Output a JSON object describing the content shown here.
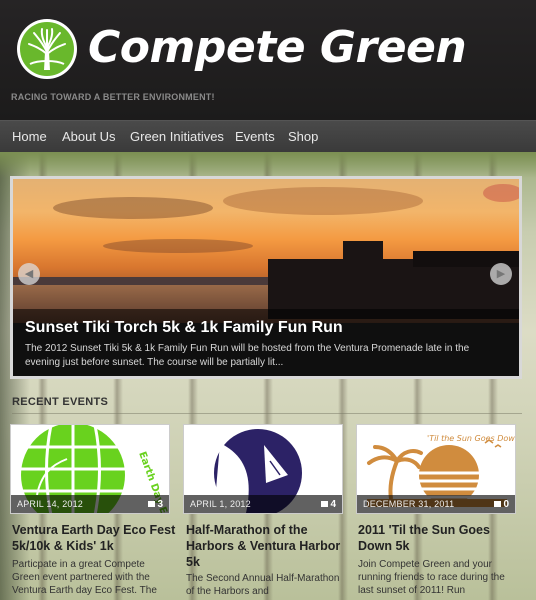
{
  "site": {
    "title": "Compete Green",
    "tagline": "RACING TOWARD A BETTER ENVIRONMENT!"
  },
  "nav": {
    "items": [
      "Home",
      "About Us",
      "Green Initiatives",
      "Events",
      "Shop"
    ]
  },
  "slider": {
    "title": "Sunset Tiki Torch 5k & 1k Family Fun Run",
    "description": "The 2012 Sunset Tiki 5k & 1k Family Fun Run will be hosted from the Ventura Promenade late in the evening just before sunset. The course will be partially lit...",
    "prev_icon": "arrow-left-icon",
    "next_icon": "arrow-right-icon"
  },
  "recent_events": {
    "heading": "RECENT EVENTS",
    "items": [
      {
        "date": "APRIL 14, 2012",
        "comments": "3",
        "title": "Ventura Earth Day Eco Fest 5k/10k & Kids' 1k",
        "text": "Particpate in a great Compete Green event partnered with the Ventura Earth day Eco Fest. The",
        "image_text": "Earth Day Eco"
      },
      {
        "date": "APRIL 1, 2012",
        "comments": "4",
        "title": "Half-Marathon of the Harbors & Ventura Harbor 5k",
        "text": "The Second Annual Half-Marathon of the Harbors and"
      },
      {
        "date": "DECEMBER 31, 2011",
        "comments": "0",
        "title": "2011 'Til the Sun Goes Down 5k",
        "text": "Join Compete Green and your running friends to race during the last sunset of 2011! Run",
        "image_text": "'Til the Sun Goes Down"
      }
    ]
  },
  "colors": {
    "brand_green": "#69b82c",
    "header_bg": "#262425",
    "nav_bg": "#444444",
    "harbor_navy": "#2c2266",
    "sun_orange": "#d08c3e"
  }
}
